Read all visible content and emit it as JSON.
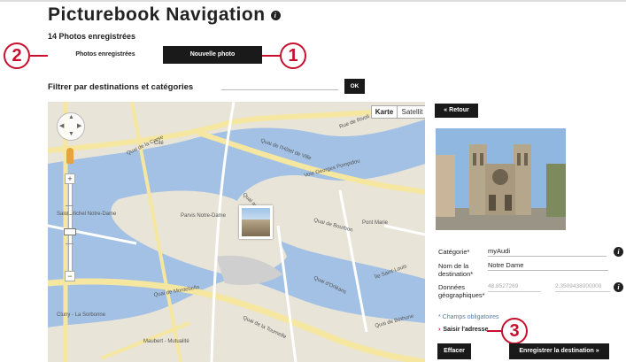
{
  "page": {
    "title": "Picturebook Navigation",
    "info_icon": "i",
    "photo_count": "14 Photos enregistrées"
  },
  "tabs": {
    "saved_label": "Photos enregistrées",
    "new_label": "Nouvelle photo"
  },
  "callouts": {
    "one": "1",
    "two": "2",
    "three": "3"
  },
  "filter": {
    "label": "Filtrer par destinations et catégories",
    "value": "",
    "ok_label": "OK"
  },
  "map": {
    "type_map": "Karte",
    "type_satellite": "Satellit",
    "zoom_in": "+",
    "zoom_out": "−",
    "labels": {
      "quai_hotel_ville": "Quai de l'Hôtel de Ville",
      "voie_pompidou": "Voie Georges Pompidou",
      "quai_corse": "Quai de la Corse",
      "quai_fleurs": "Quai aux Fleurs",
      "quai_orleans": "Quai d'Orléans",
      "quai_montebello": "Quai de Montebello",
      "quai_tournelle": "Quai de la Tournelle",
      "ile_saint_louis": "Île Saint-Louis",
      "pont_marie": "Pont Marie",
      "cite": "Cité",
      "saint_michel": "Saint-Michel Notre-Dame",
      "maubert": "Maubert - Mutualité",
      "cluny": "Cluny - La Sorbonne",
      "rue_rivoli": "Rue de Rivoli",
      "quai_bourbon": "Quai de Bourbon",
      "parvis": "Parvis Notre-Dame",
      "quai_bethune": "Quai de Béthune"
    }
  },
  "sidebar": {
    "retour_label": "« Retour",
    "categorie_label": "Catégorie*",
    "categorie_value": "myAudi",
    "nom_label_1": "Nom de la",
    "nom_label_2": "destination*",
    "nom_value": "Notre Dame",
    "geo_label_1": "Données",
    "geo_label_2": "géographiques*",
    "lat_value": "48.8527269",
    "lng_value": "2.3509438000000",
    "required_note": "* Champs obligatoires",
    "saisir_label": "Saisir l'adresse",
    "effacer_label": "Effacer",
    "save_label": "Enregistrer la destination »"
  },
  "colors": {
    "accent": "#c8102e",
    "dark_button": "#1a1a1a",
    "water": "#a3c1e4",
    "road": "#f5e6a0"
  }
}
